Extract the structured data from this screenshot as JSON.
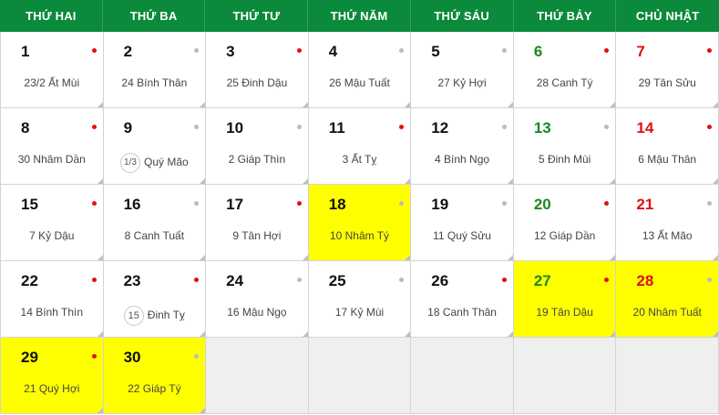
{
  "weekdays": [
    "THỨ HAI",
    "THỨ BA",
    "THỨ TƯ",
    "THỨ NĂM",
    "THỨ SÁU",
    "THỨ BẢY",
    "CHỦ NHẬT"
  ],
  "days": [
    {
      "solar": "1",
      "lunar": "23/2 Ất Mùi",
      "moon": "",
      "dot": "good",
      "hl": false
    },
    {
      "solar": "2",
      "lunar": "24 Bính Thân",
      "moon": "",
      "dot": "gray",
      "hl": false
    },
    {
      "solar": "3",
      "lunar": "25 Đinh Dậu",
      "moon": "",
      "dot": "good",
      "hl": false
    },
    {
      "solar": "4",
      "lunar": "26 Mậu Tuất",
      "moon": "",
      "dot": "gray",
      "hl": false
    },
    {
      "solar": "5",
      "lunar": "27 Kỷ Hợi",
      "moon": "",
      "dot": "gray",
      "hl": false
    },
    {
      "solar": "6",
      "lunar": "28 Canh Tý",
      "moon": "",
      "dot": "good",
      "hl": false
    },
    {
      "solar": "7",
      "lunar": "29 Tân Sửu",
      "moon": "",
      "dot": "good",
      "hl": false
    },
    {
      "solar": "8",
      "lunar": "30 Nhâm Dần",
      "moon": "",
      "dot": "good",
      "hl": false
    },
    {
      "solar": "9",
      "lunar": "Quý Mão",
      "moon": "1/3",
      "dot": "gray",
      "hl": false
    },
    {
      "solar": "10",
      "lunar": "2 Giáp Thìn",
      "moon": "",
      "dot": "gray",
      "hl": false
    },
    {
      "solar": "11",
      "lunar": "3 Ất Tỵ",
      "moon": "",
      "dot": "good",
      "hl": false
    },
    {
      "solar": "12",
      "lunar": "4 Bính Ngọ",
      "moon": "",
      "dot": "gray",
      "hl": false
    },
    {
      "solar": "13",
      "lunar": "5 Đinh Mùi",
      "moon": "",
      "dot": "gray",
      "hl": false
    },
    {
      "solar": "14",
      "lunar": "6 Mậu Thân",
      "moon": "",
      "dot": "good",
      "hl": false
    },
    {
      "solar": "15",
      "lunar": "7 Kỷ Dậu",
      "moon": "",
      "dot": "good",
      "hl": false
    },
    {
      "solar": "16",
      "lunar": "8 Canh Tuất",
      "moon": "",
      "dot": "gray",
      "hl": false
    },
    {
      "solar": "17",
      "lunar": "9 Tân Hợi",
      "moon": "",
      "dot": "good",
      "hl": false
    },
    {
      "solar": "18",
      "lunar": "10 Nhâm Tý",
      "moon": "",
      "dot": "gray",
      "hl": true
    },
    {
      "solar": "19",
      "lunar": "11 Quý Sửu",
      "moon": "",
      "dot": "gray",
      "hl": false
    },
    {
      "solar": "20",
      "lunar": "12 Giáp Dần",
      "moon": "",
      "dot": "good",
      "hl": false
    },
    {
      "solar": "21",
      "lunar": "13 Ất Mão",
      "moon": "",
      "dot": "gray",
      "hl": false
    },
    {
      "solar": "22",
      "lunar": "14 Bính Thìn",
      "moon": "",
      "dot": "good",
      "hl": false
    },
    {
      "solar": "23",
      "lunar": "Đinh Tỵ",
      "moon": "15",
      "dot": "good",
      "hl": false
    },
    {
      "solar": "24",
      "lunar": "16 Mậu Ngọ",
      "moon": "",
      "dot": "gray",
      "hl": false
    },
    {
      "solar": "25",
      "lunar": "17 Kỷ Mùi",
      "moon": "",
      "dot": "gray",
      "hl": false
    },
    {
      "solar": "26",
      "lunar": "18 Canh Thân",
      "moon": "",
      "dot": "good",
      "hl": false
    },
    {
      "solar": "27",
      "lunar": "19 Tân Dậu",
      "moon": "",
      "dot": "good",
      "hl": true
    },
    {
      "solar": "28",
      "lunar": "20 Nhâm Tuất",
      "moon": "",
      "dot": "gray",
      "hl": true
    },
    {
      "solar": "29",
      "lunar": "21 Quý Hợi",
      "moon": "",
      "dot": "good",
      "hl": true
    },
    {
      "solar": "30",
      "lunar": "22 Giáp Tý",
      "moon": "",
      "dot": "gray",
      "hl": true
    }
  ],
  "colors": {
    "header": "#0b8a3c",
    "highlight": "#ffff00",
    "saturday": "#1a8a1a",
    "sunday": "#e01010",
    "good_day_dot": "#e01010",
    "normal_day_dot": "#bbbbbb"
  }
}
